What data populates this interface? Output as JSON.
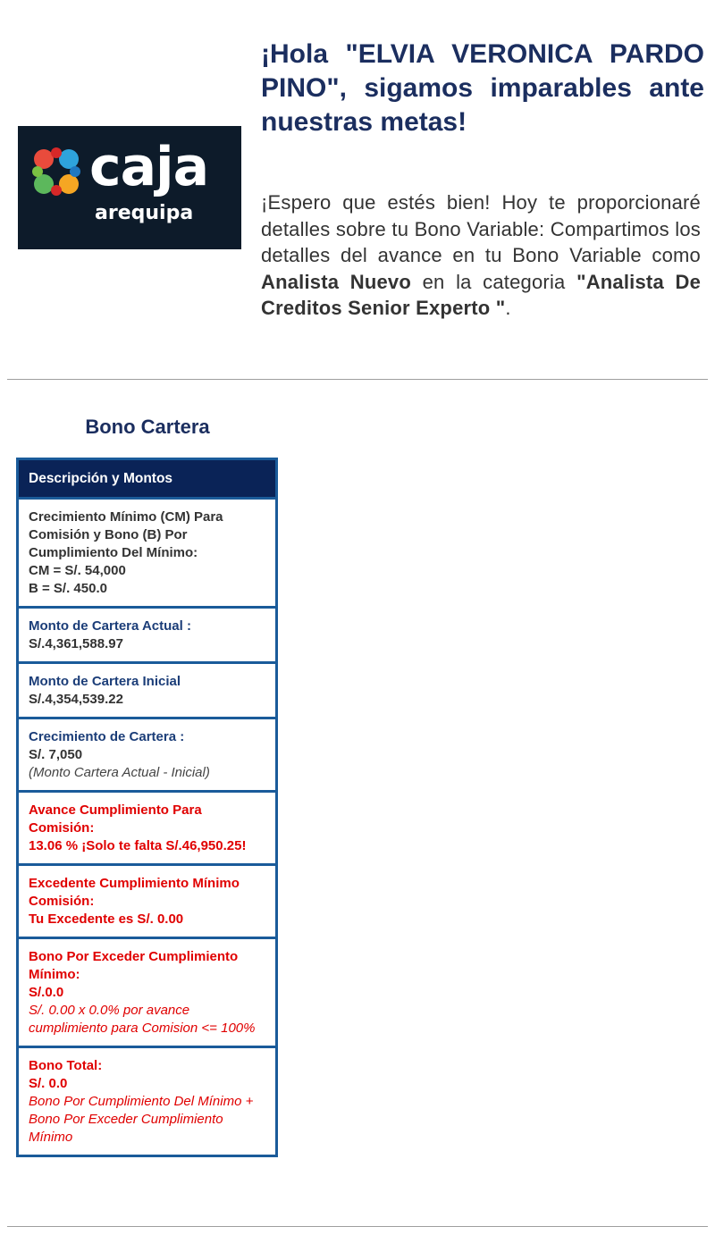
{
  "header": {
    "logo_text": "caja",
    "logo_subtext": "arequipa",
    "greeting": "¡Hola \"ELVIA VERONICA PARDO PINO\", sigamos imparables ante nuestras metas!",
    "intro_prefix": "¡Espero que estés bien! Hoy te proporcionaré detalles sobre tu Bono Variable: Compartimos los detalles del avance en tu Bono Variable como ",
    "role": "Analista Nuevo",
    "intro_middle": " en la categoria ",
    "category": "\"Analista De Creditos Senior Experto \"",
    "intro_suffix": "."
  },
  "section": {
    "title": "Bono Cartera",
    "table_header": "Descripción y Montos",
    "rows": [
      {
        "label": "Crecimiento Mínimo (CM) Para Comisión y Bono (B) Por Cumplimiento Del Mínimo:",
        "line1": "CM = S/. 54,000",
        "line2": "B = S/. 450.0"
      },
      {
        "label": "Monto de Cartera Actual :",
        "value": "S/.4,361,588.97"
      },
      {
        "label": "Monto de Cartera Inicial",
        "value": "S/.4,354,539.22"
      },
      {
        "label": "Crecimiento de Cartera :",
        "value": "S/. 7,050",
        "note": "(Monto Cartera Actual - Inicial)"
      },
      {
        "label": "Avance Cumplimiento Para Comisión:",
        "value": "13.06 % ¡Solo te falta S/.46,950.25!"
      },
      {
        "label": "Excedente Cumplimiento Mínimo Comisión:",
        "value": "Tu Excedente es S/. 0.00"
      },
      {
        "label": "Bono Por Exceder Cumplimiento Mínimo:",
        "value": "S/.0.0",
        "note": "S/. 0.00 x 0.0% por avance cumplimiento para Comision <= 100%"
      },
      {
        "label": "Bono Total:",
        "value": "S/. 0.0",
        "note": "Bono Por Cumplimiento Del Mínimo + Bono Por Exceder Cumplimiento Mínimo"
      }
    ]
  },
  "colors": {
    "navy": "#1b2e5f",
    "header_bg": "#0a2357",
    "border": "#1a5b9a",
    "alert_red": "#e00000",
    "logo_bg": "#0d1b2a"
  }
}
